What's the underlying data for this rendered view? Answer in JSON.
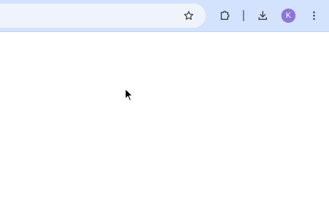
{
  "toolbar": {
    "address_value": "",
    "bookmark_icon": "star-outline-icon",
    "extensions_icon": "puzzle-piece-icon",
    "download_icon": "download-icon",
    "profile_initial": "K",
    "menu_icon": "kebab-menu-icon"
  },
  "colors": {
    "toolbar_bg": "#d3e3fd",
    "omnibox_bg": "#eef3fc",
    "profile_avatar": "#8c77d6",
    "divider_accent": "#4a8af4",
    "icon": "#474747"
  }
}
